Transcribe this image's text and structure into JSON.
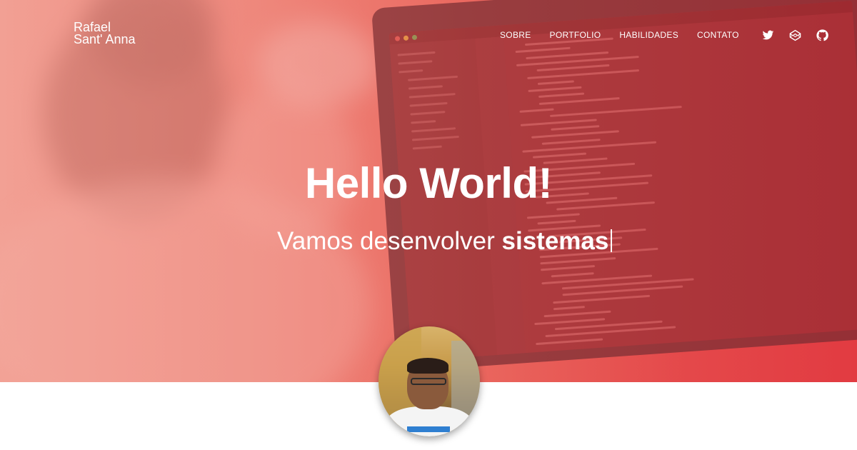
{
  "brand": {
    "line1": "Rafael",
    "line2": "Sant' Anna"
  },
  "nav": {
    "items": [
      {
        "label": "SOBRE"
      },
      {
        "label": "PORTFOLIO"
      },
      {
        "label": "HABILIDADES"
      },
      {
        "label": "CONTATO"
      }
    ],
    "icons": [
      "twitter-icon",
      "codepen-icon",
      "github-icon"
    ]
  },
  "hero": {
    "headline": "Hello World!",
    "subline_prefix": "Vamos desenvolver",
    "subline_highlight": "sistemas"
  },
  "colors": {
    "accent": "#e23d43",
    "text": "#ffffff"
  }
}
